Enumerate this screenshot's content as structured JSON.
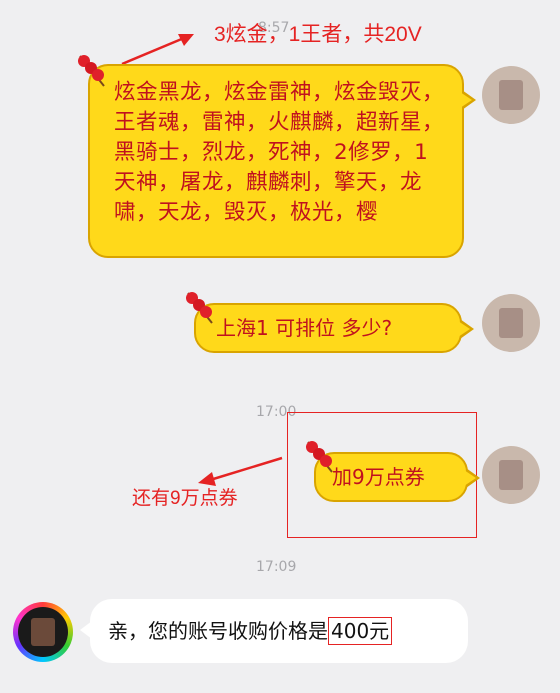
{
  "annotations": {
    "top": "3炫金，1王者，共20V",
    "middle": "还有9万点券"
  },
  "timestamps": [
    "8:57",
    "17:00",
    "17:09"
  ],
  "messages": [
    {
      "side": "right",
      "text": "炫金黑龙，炫金雷神，炫金毁灭，王者魂，雷神，火麒麟，超新星，黑骑士，烈龙，死神，2修罗，1天神，屠龙，麒麟刺，擎天，龙啸，天龙，毁灭，极光，樱"
    },
    {
      "side": "right",
      "text": "上海1 可排位 多少?"
    },
    {
      "side": "right",
      "text": "加9万点券"
    },
    {
      "side": "left",
      "text_prefix": "亲，您的账号收购价格是",
      "highlight": "400元"
    }
  ],
  "colors": {
    "bubble_yellow": "#ffd91a",
    "bubble_text": "#c0111f",
    "annotation_red": "#e52323",
    "background": "#efeff1"
  },
  "icons": [
    "candy-icon",
    "avatar"
  ]
}
